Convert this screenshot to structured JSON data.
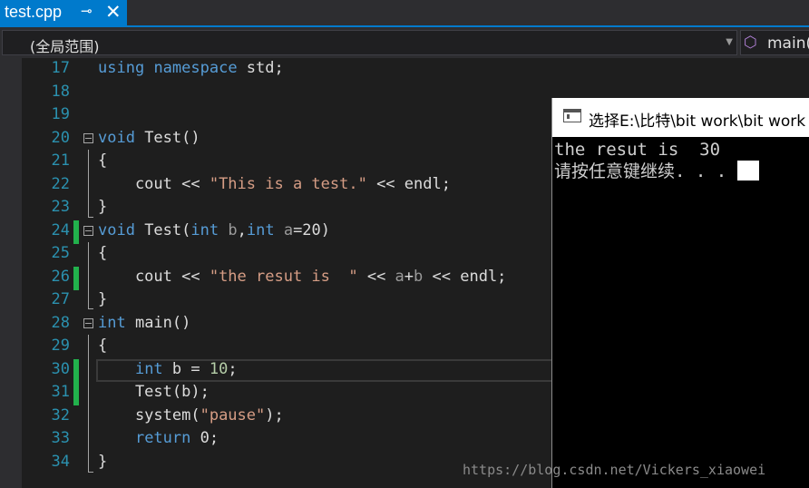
{
  "tab": {
    "title": "test.cpp",
    "pin_glyph": "⊸",
    "close_glyph": "✕"
  },
  "nav": {
    "scope": "(全局范围)",
    "member": "main("
  },
  "editor": {
    "lines": [
      {
        "num": "17",
        "tokens": [
          {
            "t": "using",
            "c": "kw"
          },
          {
            "t": " "
          },
          {
            "t": "namespace",
            "c": "kw"
          },
          {
            "t": " std;"
          }
        ]
      },
      {
        "num": "18",
        "tokens": []
      },
      {
        "num": "19",
        "tokens": []
      },
      {
        "num": "20",
        "tokens": [
          {
            "t": "void",
            "c": "kw"
          },
          {
            "t": " Test()"
          }
        ]
      },
      {
        "num": "21",
        "tokens": [
          {
            "t": "{"
          }
        ]
      },
      {
        "num": "22",
        "tokens": [
          {
            "t": "    cout << "
          },
          {
            "t": "\"This is a test.\"",
            "c": "str"
          },
          {
            "t": " << endl;"
          }
        ]
      },
      {
        "num": "23",
        "tokens": [
          {
            "t": "}"
          }
        ]
      },
      {
        "num": "24",
        "tokens": [
          {
            "t": "void",
            "c": "kw"
          },
          {
            "t": " Test("
          },
          {
            "t": "int",
            "c": "kw"
          },
          {
            "t": " "
          },
          {
            "t": "b",
            "c": "par"
          },
          {
            "t": ","
          },
          {
            "t": "int",
            "c": "kw"
          },
          {
            "t": " "
          },
          {
            "t": "a",
            "c": "par"
          },
          {
            "t": "=20)"
          }
        ]
      },
      {
        "num": "25",
        "tokens": [
          {
            "t": "{"
          }
        ]
      },
      {
        "num": "26",
        "tokens": [
          {
            "t": "    cout << "
          },
          {
            "t": "\"the resut is  \"",
            "c": "str"
          },
          {
            "t": " << "
          },
          {
            "t": "a",
            "c": "par"
          },
          {
            "t": "+"
          },
          {
            "t": "b",
            "c": "par"
          },
          {
            "t": " << endl;"
          }
        ]
      },
      {
        "num": "27",
        "tokens": [
          {
            "t": "}"
          }
        ]
      },
      {
        "num": "28",
        "tokens": [
          {
            "t": "int",
            "c": "kw"
          },
          {
            "t": " main()"
          }
        ]
      },
      {
        "num": "29",
        "tokens": [
          {
            "t": "{"
          }
        ]
      },
      {
        "num": "30",
        "tokens": [
          {
            "t": "    "
          },
          {
            "t": "int",
            "c": "kw"
          },
          {
            "t": " b = "
          },
          {
            "t": "10",
            "c": "num"
          },
          {
            "t": ";"
          }
        ]
      },
      {
        "num": "31",
        "tokens": [
          {
            "t": "    Test(b);"
          }
        ]
      },
      {
        "num": "32",
        "tokens": [
          {
            "t": "    system("
          },
          {
            "t": "\"pause\"",
            "c": "str"
          },
          {
            "t": ");"
          }
        ]
      },
      {
        "num": "33",
        "tokens": [
          {
            "t": "    "
          },
          {
            "t": "return",
            "c": "kw"
          },
          {
            "t": " 0;"
          }
        ]
      },
      {
        "num": "34",
        "tokens": [
          {
            "t": "}"
          }
        ]
      }
    ]
  },
  "console": {
    "title": "选择E:\\比特\\bit work\\bit work",
    "output_line1": "the resut is  30",
    "output_line2": "请按任意键继续. . . "
  },
  "watermark": "https://blog.csdn.net/Vickers_xiaowei"
}
